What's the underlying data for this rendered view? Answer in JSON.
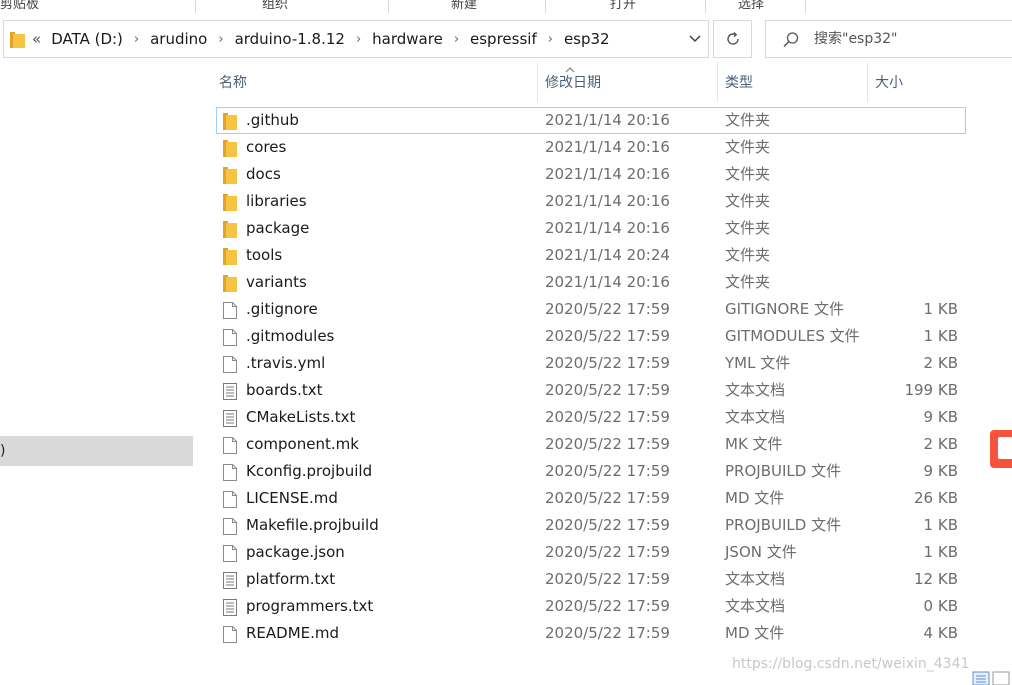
{
  "ribbon": {
    "groups": [
      "剪贴板",
      "组织",
      "新建",
      "打开",
      "选择"
    ]
  },
  "address": {
    "breadcrumbs": [
      "DATA (D:)",
      "arudino",
      "arduino-1.8.12",
      "hardware",
      "espressif",
      "esp32"
    ],
    "overflow": "«"
  },
  "search": {
    "placeholder": "搜索\"esp32\""
  },
  "nav": {
    "selected_label": ")"
  },
  "columns": {
    "name": "名称",
    "date": "修改日期",
    "type": "类型",
    "size": "大小"
  },
  "files": [
    {
      "name": ".github",
      "date": "2021/1/14 20:16",
      "type": "文件夹",
      "size": "",
      "icon": "folder-icon"
    },
    {
      "name": "cores",
      "date": "2021/1/14 20:16",
      "type": "文件夹",
      "size": "",
      "icon": "folder-icon"
    },
    {
      "name": "docs",
      "date": "2021/1/14 20:16",
      "type": "文件夹",
      "size": "",
      "icon": "folder-icon"
    },
    {
      "name": "libraries",
      "date": "2021/1/14 20:16",
      "type": "文件夹",
      "size": "",
      "icon": "folder-icon"
    },
    {
      "name": "package",
      "date": "2021/1/14 20:16",
      "type": "文件夹",
      "size": "",
      "icon": "folder-icon"
    },
    {
      "name": "tools",
      "date": "2021/1/14 20:24",
      "type": "文件夹",
      "size": "",
      "icon": "folder-icon"
    },
    {
      "name": "variants",
      "date": "2021/1/14 20:16",
      "type": "文件夹",
      "size": "",
      "icon": "folder-icon"
    },
    {
      "name": ".gitignore",
      "date": "2020/5/22 17:59",
      "type": "GITIGNORE 文件",
      "size": "1 KB",
      "icon": "file-icon"
    },
    {
      "name": ".gitmodules",
      "date": "2020/5/22 17:59",
      "type": "GITMODULES 文件",
      "size": "1 KB",
      "icon": "file-icon"
    },
    {
      "name": ".travis.yml",
      "date": "2020/5/22 17:59",
      "type": "YML 文件",
      "size": "2 KB",
      "icon": "file-icon"
    },
    {
      "name": "boards.txt",
      "date": "2020/5/22 17:59",
      "type": "文本文档",
      "size": "199 KB",
      "icon": "text-file-icon"
    },
    {
      "name": "CMakeLists.txt",
      "date": "2020/5/22 17:59",
      "type": "文本文档",
      "size": "9 KB",
      "icon": "text-file-icon"
    },
    {
      "name": "component.mk",
      "date": "2020/5/22 17:59",
      "type": "MK 文件",
      "size": "2 KB",
      "icon": "file-icon"
    },
    {
      "name": "Kconfig.projbuild",
      "date": "2020/5/22 17:59",
      "type": "PROJBUILD 文件",
      "size": "9 KB",
      "icon": "file-icon"
    },
    {
      "name": "LICENSE.md",
      "date": "2020/5/22 17:59",
      "type": "MD 文件",
      "size": "26 KB",
      "icon": "file-icon"
    },
    {
      "name": "Makefile.projbuild",
      "date": "2020/5/22 17:59",
      "type": "PROJBUILD 文件",
      "size": "1 KB",
      "icon": "file-icon"
    },
    {
      "name": "package.json",
      "date": "2020/5/22 17:59",
      "type": "JSON 文件",
      "size": "1 KB",
      "icon": "file-icon"
    },
    {
      "name": "platform.txt",
      "date": "2020/5/22 17:59",
      "type": "文本文档",
      "size": "12 KB",
      "icon": "text-file-icon"
    },
    {
      "name": "programmers.txt",
      "date": "2020/5/22 17:59",
      "type": "文本文档",
      "size": "0 KB",
      "icon": "text-file-icon"
    },
    {
      "name": "README.md",
      "date": "2020/5/22 17:59",
      "type": "MD 文件",
      "size": "4 KB",
      "icon": "file-icon"
    }
  ],
  "selected_index": 0,
  "watermark": "https://blog.csdn.net/weixin_4341",
  "colors": {
    "folder": "#f6c343",
    "selection_border": "#99d1ff",
    "header_text": "#4c607a",
    "secondary_text": "#6d6d6d"
  }
}
